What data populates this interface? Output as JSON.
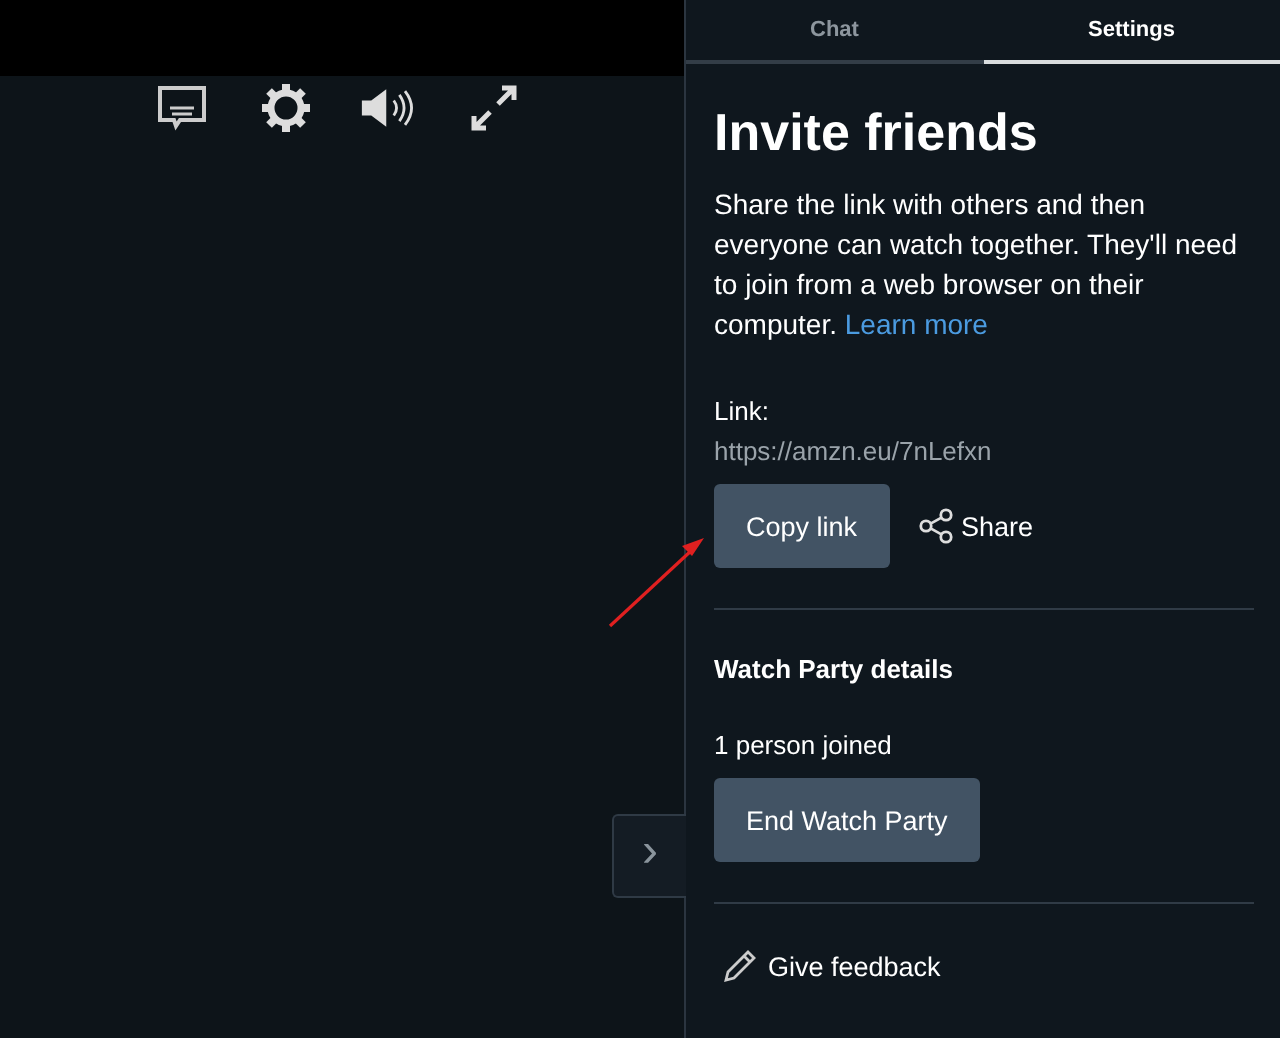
{
  "player": {
    "controls": [
      {
        "kind": "subtitles"
      },
      {
        "kind": "settings"
      },
      {
        "kind": "volume"
      },
      {
        "kind": "fullscreen"
      }
    ],
    "expand_button": "›"
  },
  "tabs": [
    {
      "label": "Chat",
      "selected": false
    },
    {
      "label": "Settings",
      "selected": true
    }
  ],
  "invite": {
    "title": "Invite friends",
    "description": "Share the link with others and then everyone can watch together. They'll need to join from a web browser on their computer.",
    "learn_more": "Learn more",
    "link_label": "Link:",
    "link_url": "https://amzn.eu/7nLefxn",
    "copy_button": "Copy link",
    "share_button": "Share"
  },
  "details": {
    "title": "Watch Party details",
    "joined": "1 person joined",
    "end_button": "End Watch Party"
  },
  "feedback": "Give feedback"
}
